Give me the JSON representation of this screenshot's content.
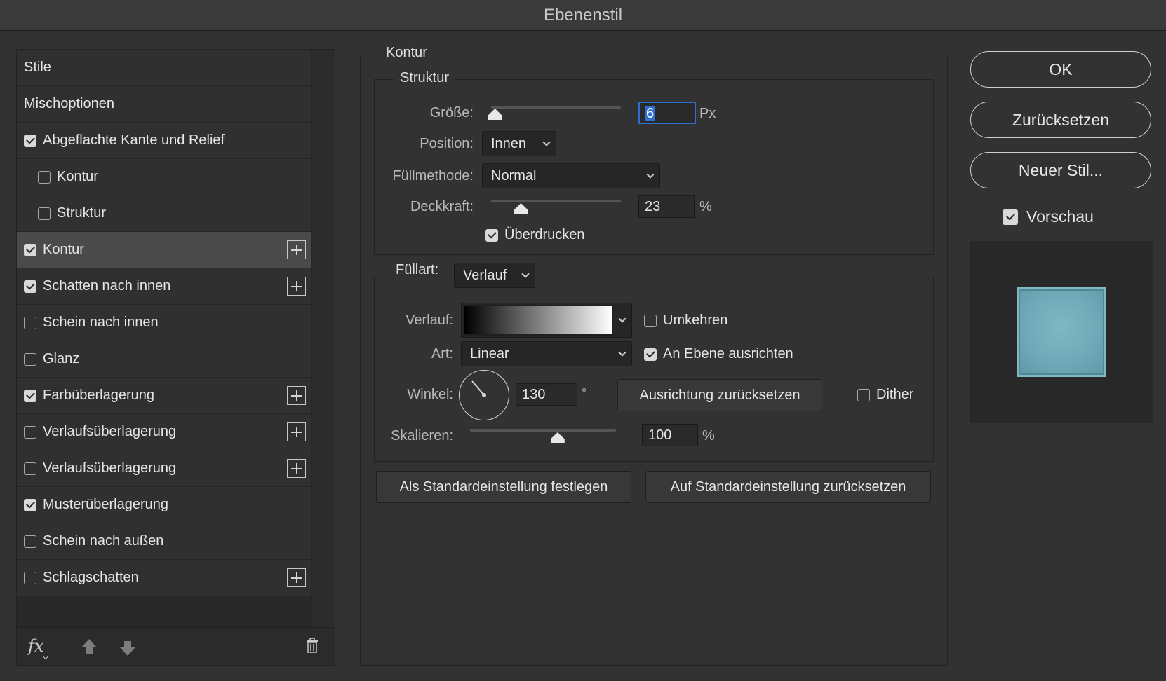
{
  "window": {
    "title": "Ebenenstil"
  },
  "sidebar": {
    "items": [
      {
        "label": "Stile",
        "checkbox": null,
        "indent": 0,
        "add": false,
        "selected": false
      },
      {
        "label": "Mischoptionen",
        "checkbox": null,
        "indent": 0,
        "add": false,
        "selected": false
      },
      {
        "label": "Abgeflachte Kante und Relief",
        "checkbox": true,
        "indent": 0,
        "add": false,
        "selected": false
      },
      {
        "label": "Kontur",
        "checkbox": false,
        "indent": 1,
        "add": false,
        "selected": false
      },
      {
        "label": "Struktur",
        "checkbox": false,
        "indent": 1,
        "add": false,
        "selected": false
      },
      {
        "label": "Kontur",
        "checkbox": true,
        "indent": 0,
        "add": true,
        "selected": true
      },
      {
        "label": "Schatten nach innen",
        "checkbox": true,
        "indent": 0,
        "add": true,
        "selected": false
      },
      {
        "label": "Schein nach innen",
        "checkbox": false,
        "indent": 0,
        "add": false,
        "selected": false
      },
      {
        "label": "Glanz",
        "checkbox": false,
        "indent": 0,
        "add": false,
        "selected": false
      },
      {
        "label": "Farbüberlagerung",
        "checkbox": true,
        "indent": 0,
        "add": true,
        "selected": false
      },
      {
        "label": "Verlaufsüberlagerung",
        "checkbox": false,
        "indent": 0,
        "add": true,
        "selected": false
      },
      {
        "label": "Verlaufsüberlagerung",
        "checkbox": false,
        "indent": 0,
        "add": true,
        "selected": false
      },
      {
        "label": "Musterüberlagerung",
        "checkbox": true,
        "indent": 0,
        "add": false,
        "selected": false
      },
      {
        "label": "Schein nach außen",
        "checkbox": false,
        "indent": 0,
        "add": false,
        "selected": false
      },
      {
        "label": "Schlagschatten",
        "checkbox": false,
        "indent": 0,
        "add": true,
        "selected": false
      }
    ],
    "footer": {
      "fx": "fx",
      "icons": [
        "fx-icon",
        "move-up-icon",
        "move-down-icon",
        "trash-icon"
      ]
    }
  },
  "kontur": {
    "title": "Kontur",
    "struktur": {
      "title": "Struktur",
      "groesse_label": "Größe:",
      "groesse_value": "6",
      "groesse_unit": "Px",
      "groesse_slider_fraction": 0.03,
      "position_label": "Position:",
      "position_value": "Innen",
      "fuellmethode_label": "Füllmethode:",
      "fuellmethode_value": "Normal",
      "deckkraft_label": "Deckkraft:",
      "deckkraft_value": "23",
      "deckkraft_unit": "%",
      "ueberdrucken_label": "Überdrucken",
      "ueberdrucken_checked": true
    },
    "fuellart": {
      "label": "Füllart:",
      "value": "Verlauf",
      "verlauf_label": "Verlauf:",
      "umkehren_label": "Umkehren",
      "umkehren_checked": false,
      "art_label": "Art:",
      "art_value": "Linear",
      "an_ebene_label": "An Ebene ausrichten",
      "an_ebene_checked": true,
      "winkel_label": "Winkel:",
      "winkel_value": "130",
      "winkel_unit": "°",
      "ausrichtung_button": "Ausrichtung zurücksetzen",
      "dither_label": "Dither",
      "dither_checked": false,
      "skalieren_label": "Skalieren:",
      "skalieren_value": "100",
      "skalieren_unit": "%",
      "skalieren_slider_fraction": 0.6
    },
    "buttons": {
      "set_default": "Als Standardeinstellung festlegen",
      "reset_default": "Auf Standardeinstellung zurücksetzen"
    }
  },
  "actions": {
    "ok": "OK",
    "reset": "Zurücksetzen",
    "new_style": "Neuer Stil...",
    "preview_label": "Vorschau",
    "preview_checked": true,
    "preview_swatch_color": "#70a9b8"
  }
}
